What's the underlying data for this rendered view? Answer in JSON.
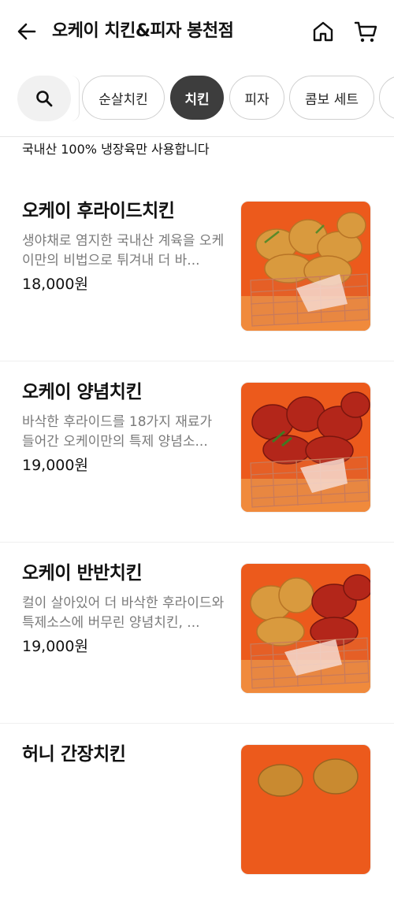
{
  "header": {
    "title": "오케이 치킨&피자 봉천점",
    "icons": {
      "back": "arrow-left-icon",
      "home": "home-icon",
      "cart": "cart-icon"
    }
  },
  "categories": {
    "search_icon": "search-icon",
    "chips": [
      {
        "label": "순살치킨",
        "active": false
      },
      {
        "label": "치킨",
        "active": true
      },
      {
        "label": "피자",
        "active": false
      },
      {
        "label": "콤보 세트",
        "active": false
      }
    ]
  },
  "notice": "국내산 100% 냉장육만 사용합니다",
  "menu": [
    {
      "name": "오케이 후라이드치킨",
      "desc": "생야채로 염지한 국내산 계육을 오케이만의 비법으로 튀겨내 더 바...",
      "price": "18,000원",
      "style": "fried"
    },
    {
      "name": "오케이 양념치킨",
      "desc": "바삭한 후라이드를 18가지 재료가 들어간 오케이만의 특제 양념소...",
      "price": "19,000원",
      "style": "sauced"
    },
    {
      "name": "오케이 반반치킨",
      "desc": "컬이 살아있어 더 바삭한 후라이드와 특제소스에 버무린 양념치킨, ...",
      "price": "19,000원",
      "style": "half"
    },
    {
      "name": "허니 간장치킨",
      "desc": "",
      "price": "",
      "style": "fried"
    }
  ],
  "colors": {
    "chip_active_bg": "#3d3d3d",
    "photo_bg": "#ec5a1c",
    "fried": "#d99a3e",
    "sauced": "#b3261a"
  }
}
